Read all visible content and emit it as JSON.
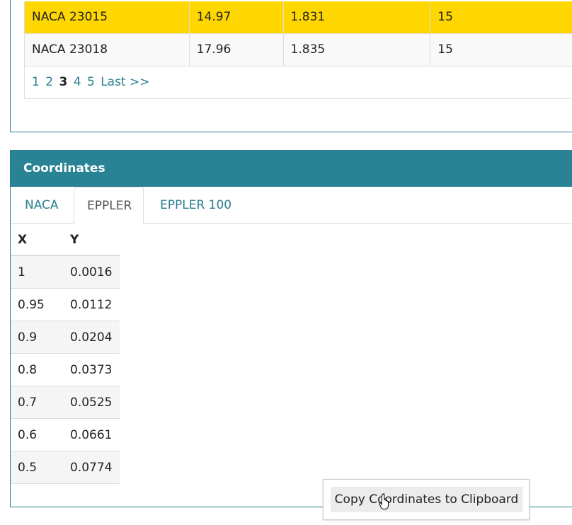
{
  "airfoil_list": {
    "rows": [
      {
        "name": "NACA 23015",
        "col2": "14.97",
        "col3": "1.831",
        "col4": "15",
        "highlight": true
      },
      {
        "name": "NACA 23018",
        "col2": "17.96",
        "col3": "1.835",
        "col4": "15",
        "highlight": false
      }
    ],
    "pager": {
      "pages": [
        "1",
        "2",
        "3",
        "4",
        "5"
      ],
      "current": "3",
      "last_label": "Last >>"
    }
  },
  "coordinates": {
    "title": "Coordinates",
    "tabs": [
      {
        "label": "NACA",
        "active": false
      },
      {
        "label": "EPPLER",
        "active": true
      },
      {
        "label": "EPPLER 100",
        "active": false
      }
    ],
    "table": {
      "headers": [
        "X",
        "Y"
      ],
      "rows": [
        [
          "1",
          "0.0016"
        ],
        [
          "0.95",
          "0.0112"
        ],
        [
          "0.9",
          "0.0204"
        ],
        [
          "0.8",
          "0.0373"
        ],
        [
          "0.7",
          "0.0525"
        ],
        [
          "0.6",
          "0.0661"
        ],
        [
          "0.5",
          "0.0774"
        ]
      ]
    },
    "copy_button_label": "Copy Coordinates to Clipboard"
  },
  "icons": {
    "cursor": "hand-pointer-icon"
  },
  "colors": {
    "accent": "#2a8394",
    "highlight_row": "#ffd700",
    "link": "#2a7f8f"
  }
}
